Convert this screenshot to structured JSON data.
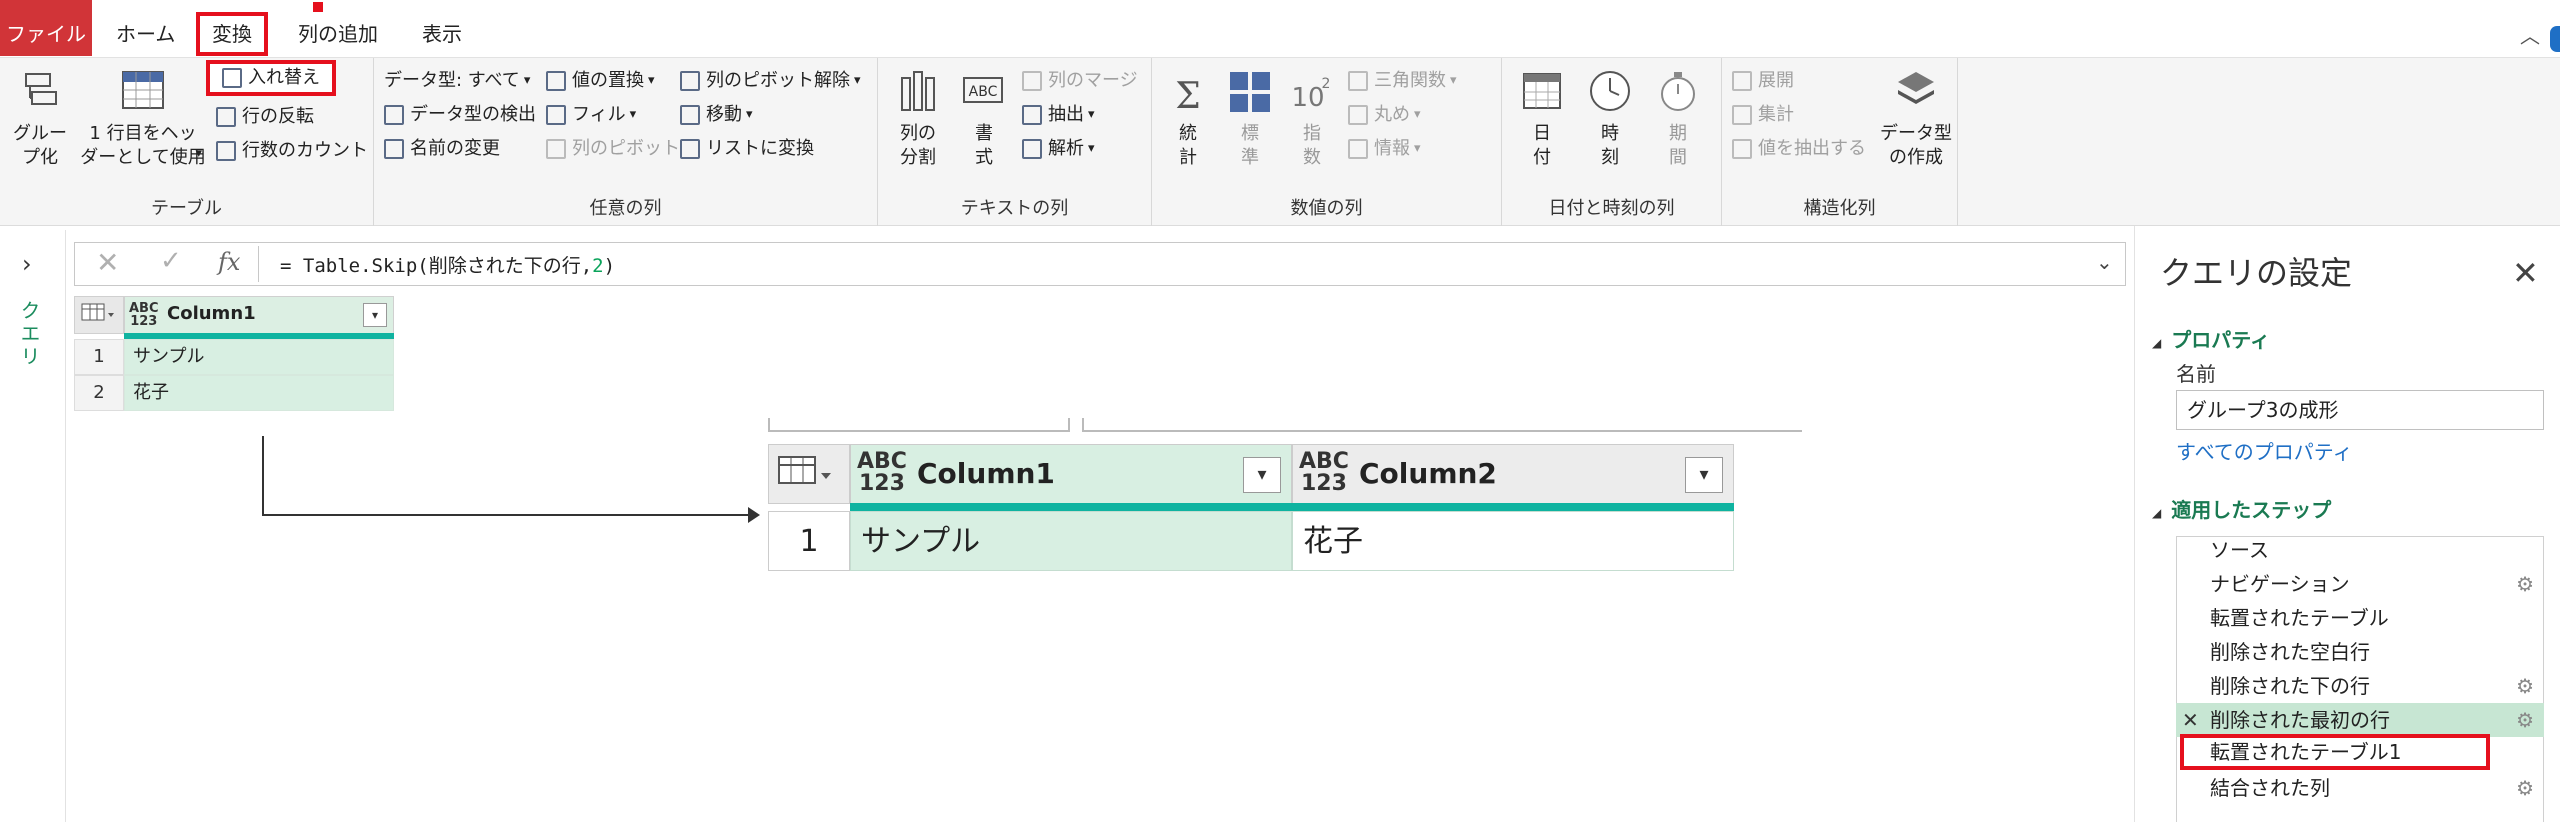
{
  "tabs": {
    "file": "ファイル",
    "home": "ホーム",
    "transform": "変換",
    "add_column": "列の追加",
    "view": "表示"
  },
  "ribbon": {
    "table": {
      "label": "テーブル",
      "group_by": "グルー\nプ化",
      "use_first_row": "1 行目をヘッ\nダーとして使用",
      "swap": "入れ替え",
      "reverse_rows": "行の反転",
      "count_rows": "行数のカウント"
    },
    "any_column": {
      "label": "任意の列",
      "data_type": "データ型: すべて",
      "detect_type": "データ型の検出",
      "rename": "名前の変更",
      "replace_values": "値の置換",
      "fill": "フィル",
      "pivot": "列のピボット",
      "unpivot": "列のピボット解除",
      "move": "移動",
      "to_list": "リストに変換"
    },
    "text_column": {
      "label": "テキストの列",
      "split": "列の\n分割",
      "format": "書\n式",
      "merge": "列のマージ",
      "extract": "抽出",
      "parse": "解析",
      "abc_label": "ABC"
    },
    "number_column": {
      "label": "数値の列",
      "statistics": "統\n計",
      "standard": "標\n準",
      "scientific": "指\n数",
      "scientific_symbol": "10",
      "trig": "三角関数",
      "round": "丸め",
      "info": "情報"
    },
    "datetime_column": {
      "label": "日付と時刻の列",
      "date": "日\n付",
      "time": "時\n刻",
      "duration": "期\n間"
    },
    "structured_column": {
      "label": "構造化列",
      "expand": "展開",
      "aggregate": "集計",
      "extract_values": "値を抽出する",
      "create_type": "データ型\nの作成"
    }
  },
  "nav": {
    "queries_label": "クエリ"
  },
  "formula": {
    "prefix": "= Table.Skip(削除された下の行,",
    "arg": "2",
    "suffix": ")"
  },
  "small_grid": {
    "column": "Column1",
    "type_label": "ABC\n123",
    "rows": [
      {
        "num": "1",
        "value": "サンプル"
      },
      {
        "num": "2",
        "value": "花子"
      }
    ]
  },
  "big_grid": {
    "type_label": "ABC\n123",
    "columns": [
      "Column1",
      "Column2"
    ],
    "row_num": "1",
    "values": [
      "サンプル",
      "花子"
    ]
  },
  "query_settings": {
    "title": "クエリの設定",
    "properties_label": "プロパティ",
    "name_label": "名前",
    "name_value": "グループ3の成形",
    "all_properties": "すべてのプロパティ",
    "applied_steps_label": "適用したステップ",
    "steps": [
      "ソース",
      "ナビゲーション",
      "転置されたテーブル",
      "削除された空白行",
      "削除された下の行",
      "削除された最初の行",
      "転置されたテーブル1",
      "結合された列"
    ]
  },
  "colors": {
    "accent_green": "#1a7a52",
    "teal": "#0fb3a0",
    "cell_green": "#d8efe2",
    "file_red": "#d13438",
    "highlight_red": "#e5101d",
    "link_blue": "#1f6fc5"
  }
}
